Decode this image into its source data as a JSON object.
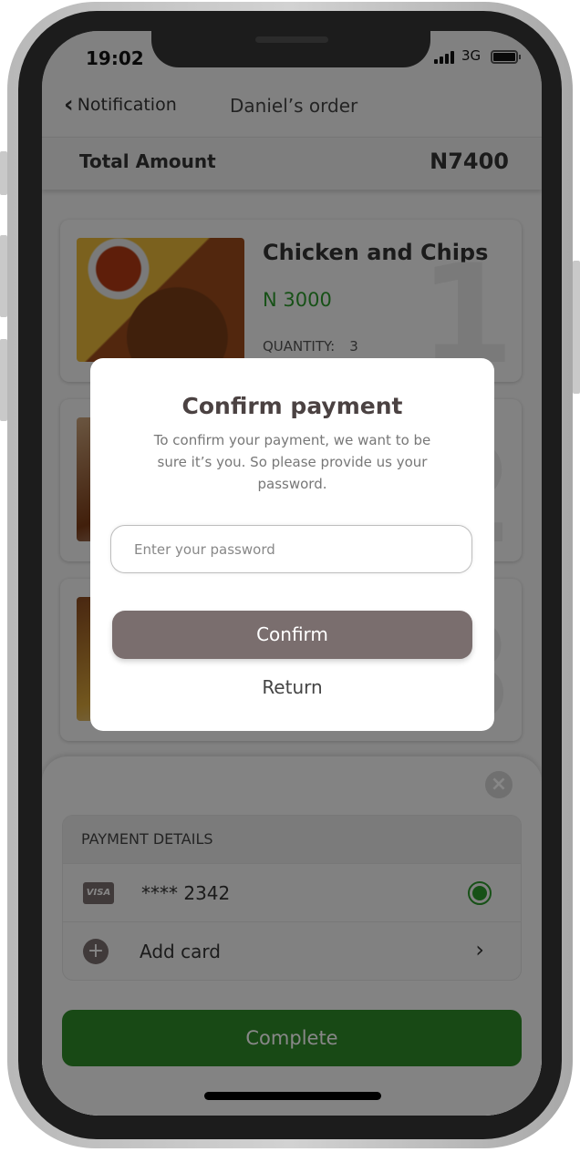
{
  "status_bar": {
    "time": "19:02",
    "network": "3G",
    "battery_icon": "battery-full-icon",
    "signal_icon": "signal-bars-icon"
  },
  "nav": {
    "back_label": "Notification",
    "back_icon": "chevron-left-icon",
    "title": "Daniel’s order"
  },
  "summary": {
    "total_label": "Total Amount",
    "total_value": "N7400"
  },
  "orders": [
    {
      "name": "Chicken and Chips",
      "price": "N 3000",
      "quantity_label": "QUANTITY:",
      "quantity": "3",
      "index": "1"
    },
    {
      "name": "",
      "price": "",
      "quantity_label": "",
      "quantity": "",
      "index": "2"
    },
    {
      "name": "",
      "price": "",
      "quantity_label": "",
      "quantity": "",
      "index": "3"
    }
  ],
  "payment": {
    "close_icon": "close-icon",
    "header": "PAYMENT DETAILS",
    "card": {
      "brand": "VISA",
      "number": "**** 2342",
      "selected": true
    },
    "add_card_label": "Add card",
    "complete_label": "Complete"
  },
  "modal": {
    "title": "Confirm payment",
    "description": "To confirm your payment, we want to be sure it’s you. So please provide us your password.",
    "password_placeholder": "Enter your password",
    "password_value": "",
    "confirm_label": "Confirm",
    "return_label": "Return"
  },
  "colors": {
    "accent_green": "#2f8a28",
    "price_green": "#2d9a2d",
    "confirm_brown": "#7a6e6e"
  }
}
